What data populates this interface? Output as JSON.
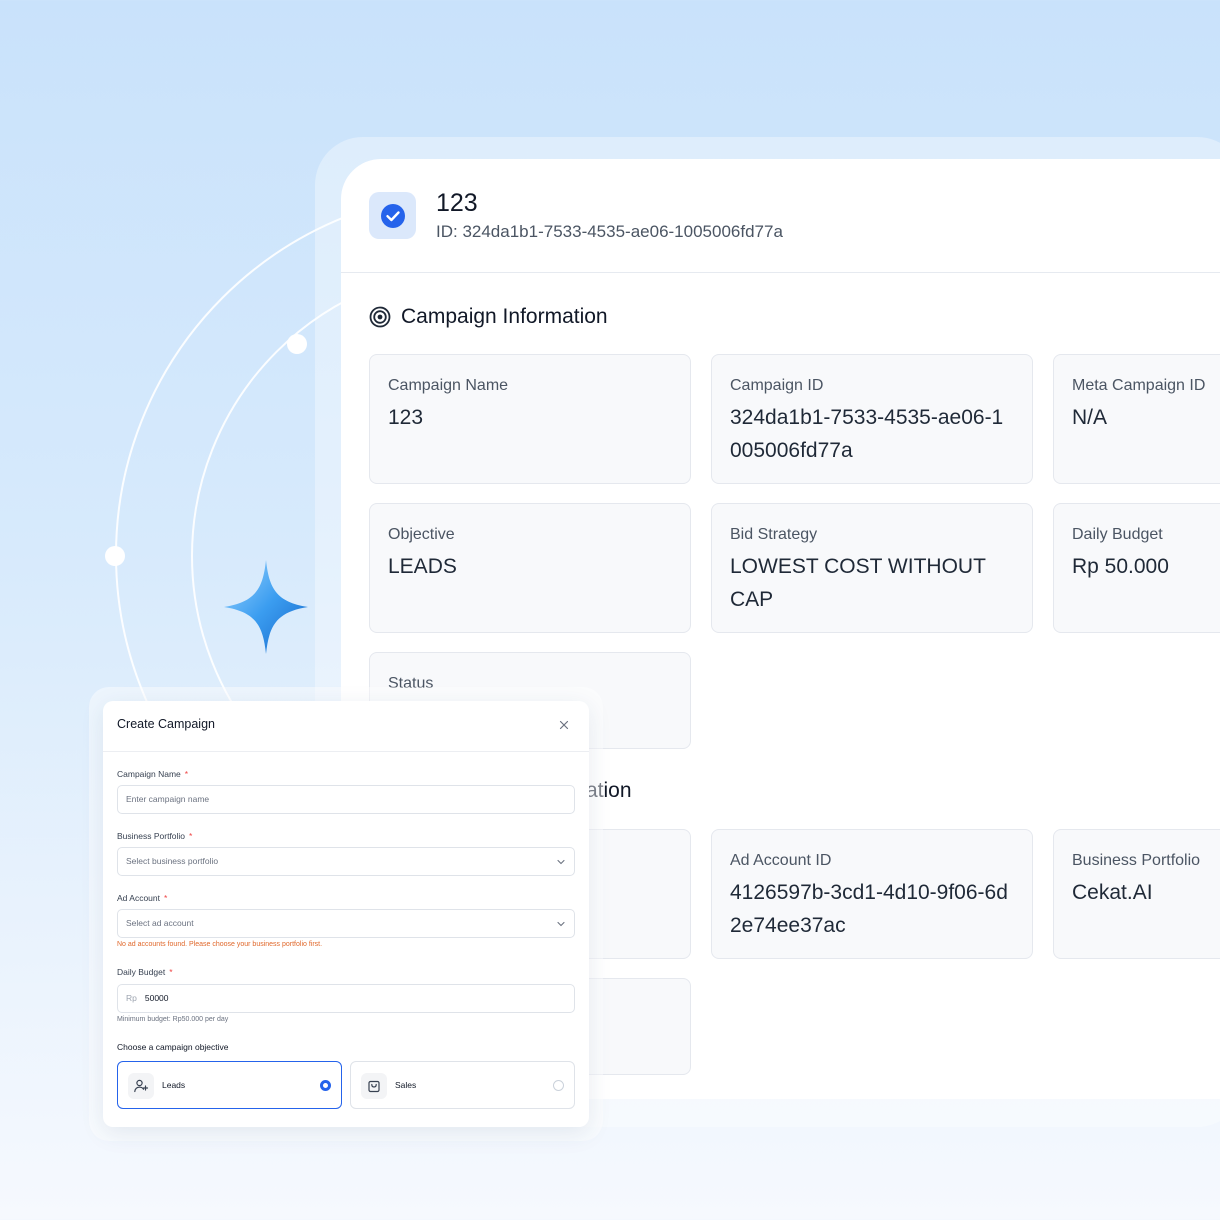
{
  "detail": {
    "title": "123",
    "id_line": "ID: 324da1b1-7533-4535-ae06-1005006fd77a"
  },
  "campaign_info": {
    "section_title": "Campaign Information",
    "cards": [
      {
        "label": "Campaign Name",
        "value": "123"
      },
      {
        "label": "Campaign ID",
        "value": "324da1b1-7533-4535-ae06-1005006fd77a"
      },
      {
        "label": "Meta Campaign ID",
        "value": "N/A"
      },
      {
        "label": "Objective",
        "value": "LEADS"
      },
      {
        "label": "Bid Strategy",
        "value": "LOWEST COST WITHOUT CAP"
      },
      {
        "label": "Daily Budget",
        "value": "Rp 50.000"
      },
      {
        "label": "Status",
        "value": ""
      }
    ]
  },
  "account_info": {
    "section_title_visible": "ation",
    "cards": [
      {
        "label": "Ad Account ID",
        "value": "4126597b-3cd1-4d10-9f06-6d2e74ee37ac"
      },
      {
        "label": "Business Portfolio",
        "value": "Cekat.AI"
      }
    ]
  },
  "modal": {
    "title": "Create Campaign",
    "campaign_name": {
      "label": "Campaign Name",
      "required": "*",
      "placeholder": "Enter campaign name"
    },
    "business_portfolio": {
      "label": "Business Portfolio",
      "required": "*",
      "placeholder": "Select business portfolio"
    },
    "ad_account": {
      "label": "Ad Account",
      "required": "*",
      "placeholder": "Select ad account",
      "error": "No ad accounts found. Please choose your business portfolio first."
    },
    "daily_budget": {
      "label": "Daily Budget",
      "required": "*",
      "prefix": "Rp",
      "value": "50000",
      "hint": "Minimum budget: Rp50.000 per day"
    },
    "objective": {
      "label": "Choose a campaign objective",
      "options": [
        {
          "label": "Leads",
          "icon": "user-plus-icon",
          "selected": true
        },
        {
          "label": "Sales",
          "icon": "shopping-bag-icon",
          "selected": false
        }
      ]
    }
  },
  "colors": {
    "accent": "#2563eb",
    "error": "#e0682b",
    "background": "#cfe5fb"
  }
}
